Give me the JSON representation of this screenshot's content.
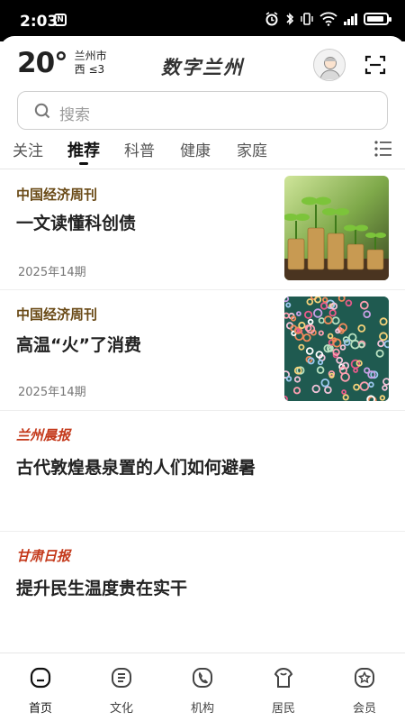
{
  "status_bar": {
    "time": "2:03",
    "nfc_glyph": "N",
    "icons": [
      "alarm-icon",
      "bluetooth-icon",
      "vibrate-icon",
      "wifi-icon",
      "signal-icon",
      "battery-icon"
    ],
    "battery_level": 0.9
  },
  "weather": {
    "temperature": "20°",
    "city": "兰州市",
    "wind": "西 ≤3"
  },
  "header": {
    "app_title": "数字兰州"
  },
  "search": {
    "placeholder": "搜索"
  },
  "tabs": [
    {
      "label": "关注",
      "active": false
    },
    {
      "label": "推荐",
      "active": true
    },
    {
      "label": "科普",
      "active": false
    },
    {
      "label": "健康",
      "active": false
    },
    {
      "label": "家庭",
      "active": false
    }
  ],
  "articles": [
    {
      "source": "中国经济周刊",
      "title": "一文读懂科创债",
      "date": "2025年14期",
      "thumbnail": "coins-seedlings-image"
    },
    {
      "source": "中国经济周刊",
      "title": "高温“火”了消费",
      "date": "2025年14期",
      "thumbnail": "colorful-beads-image"
    },
    {
      "source": "兰州晨报",
      "title": "古代敦煌悬泉置的人们如何避暑"
    },
    {
      "source": "甘肃日报",
      "title": "提升民生温度贵在实干"
    }
  ],
  "bottom_nav": [
    {
      "label": "首页",
      "icon": "home-icon",
      "active": true
    },
    {
      "label": "文化",
      "icon": "culture-icon",
      "active": false
    },
    {
      "label": "机构",
      "icon": "phone-icon",
      "active": false
    },
    {
      "label": "居民",
      "icon": "resident-icon",
      "active": false
    },
    {
      "label": "会员",
      "icon": "member-star-icon",
      "active": false
    }
  ],
  "colors": {
    "source_brown": "#6a4a16",
    "source_red": "#c4391b",
    "text_dark": "#222222",
    "muted": "#777777"
  }
}
